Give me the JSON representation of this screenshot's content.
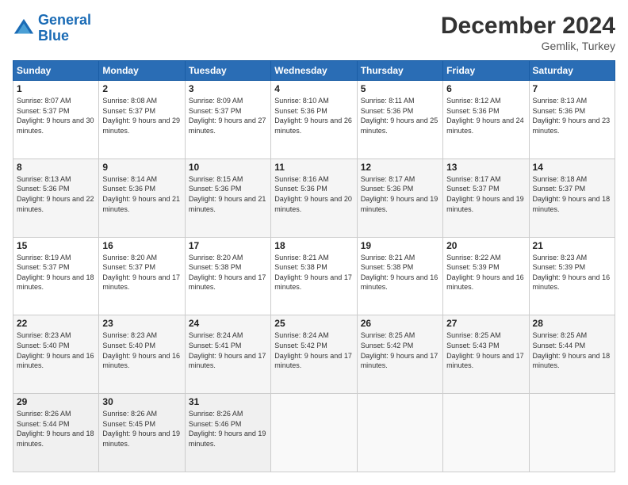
{
  "header": {
    "logo_line1": "General",
    "logo_line2": "Blue",
    "month_title": "December 2024",
    "subtitle": "Gemlik, Turkey"
  },
  "days_of_week": [
    "Sunday",
    "Monday",
    "Tuesday",
    "Wednesday",
    "Thursday",
    "Friday",
    "Saturday"
  ],
  "weeks": [
    [
      {
        "day": "1",
        "sunrise": "8:07 AM",
        "sunset": "5:37 PM",
        "daylight": "9 hours and 30 minutes."
      },
      {
        "day": "2",
        "sunrise": "8:08 AM",
        "sunset": "5:37 PM",
        "daylight": "9 hours and 29 minutes."
      },
      {
        "day": "3",
        "sunrise": "8:09 AM",
        "sunset": "5:37 PM",
        "daylight": "9 hours and 27 minutes."
      },
      {
        "day": "4",
        "sunrise": "8:10 AM",
        "sunset": "5:36 PM",
        "daylight": "9 hours and 26 minutes."
      },
      {
        "day": "5",
        "sunrise": "8:11 AM",
        "sunset": "5:36 PM",
        "daylight": "9 hours and 25 minutes."
      },
      {
        "day": "6",
        "sunrise": "8:12 AM",
        "sunset": "5:36 PM",
        "daylight": "9 hours and 24 minutes."
      },
      {
        "day": "7",
        "sunrise": "8:13 AM",
        "sunset": "5:36 PM",
        "daylight": "9 hours and 23 minutes."
      }
    ],
    [
      {
        "day": "8",
        "sunrise": "8:13 AM",
        "sunset": "5:36 PM",
        "daylight": "9 hours and 22 minutes."
      },
      {
        "day": "9",
        "sunrise": "8:14 AM",
        "sunset": "5:36 PM",
        "daylight": "9 hours and 21 minutes."
      },
      {
        "day": "10",
        "sunrise": "8:15 AM",
        "sunset": "5:36 PM",
        "daylight": "9 hours and 21 minutes."
      },
      {
        "day": "11",
        "sunrise": "8:16 AM",
        "sunset": "5:36 PM",
        "daylight": "9 hours and 20 minutes."
      },
      {
        "day": "12",
        "sunrise": "8:17 AM",
        "sunset": "5:36 PM",
        "daylight": "9 hours and 19 minutes."
      },
      {
        "day": "13",
        "sunrise": "8:17 AM",
        "sunset": "5:37 PM",
        "daylight": "9 hours and 19 minutes."
      },
      {
        "day": "14",
        "sunrise": "8:18 AM",
        "sunset": "5:37 PM",
        "daylight": "9 hours and 18 minutes."
      }
    ],
    [
      {
        "day": "15",
        "sunrise": "8:19 AM",
        "sunset": "5:37 PM",
        "daylight": "9 hours and 18 minutes."
      },
      {
        "day": "16",
        "sunrise": "8:20 AM",
        "sunset": "5:37 PM",
        "daylight": "9 hours and 17 minutes."
      },
      {
        "day": "17",
        "sunrise": "8:20 AM",
        "sunset": "5:38 PM",
        "daylight": "9 hours and 17 minutes."
      },
      {
        "day": "18",
        "sunrise": "8:21 AM",
        "sunset": "5:38 PM",
        "daylight": "9 hours and 17 minutes."
      },
      {
        "day": "19",
        "sunrise": "8:21 AM",
        "sunset": "5:38 PM",
        "daylight": "9 hours and 16 minutes."
      },
      {
        "day": "20",
        "sunrise": "8:22 AM",
        "sunset": "5:39 PM",
        "daylight": "9 hours and 16 minutes."
      },
      {
        "day": "21",
        "sunrise": "8:23 AM",
        "sunset": "5:39 PM",
        "daylight": "9 hours and 16 minutes."
      }
    ],
    [
      {
        "day": "22",
        "sunrise": "8:23 AM",
        "sunset": "5:40 PM",
        "daylight": "9 hours and 16 minutes."
      },
      {
        "day": "23",
        "sunrise": "8:23 AM",
        "sunset": "5:40 PM",
        "daylight": "9 hours and 16 minutes."
      },
      {
        "day": "24",
        "sunrise": "8:24 AM",
        "sunset": "5:41 PM",
        "daylight": "9 hours and 17 minutes."
      },
      {
        "day": "25",
        "sunrise": "8:24 AM",
        "sunset": "5:42 PM",
        "daylight": "9 hours and 17 minutes."
      },
      {
        "day": "26",
        "sunrise": "8:25 AM",
        "sunset": "5:42 PM",
        "daylight": "9 hours and 17 minutes."
      },
      {
        "day": "27",
        "sunrise": "8:25 AM",
        "sunset": "5:43 PM",
        "daylight": "9 hours and 17 minutes."
      },
      {
        "day": "28",
        "sunrise": "8:25 AM",
        "sunset": "5:44 PM",
        "daylight": "9 hours and 18 minutes."
      }
    ],
    [
      {
        "day": "29",
        "sunrise": "8:26 AM",
        "sunset": "5:44 PM",
        "daylight": "9 hours and 18 minutes."
      },
      {
        "day": "30",
        "sunrise": "8:26 AM",
        "sunset": "5:45 PM",
        "daylight": "9 hours and 19 minutes."
      },
      {
        "day": "31",
        "sunrise": "8:26 AM",
        "sunset": "5:46 PM",
        "daylight": "9 hours and 19 minutes."
      },
      null,
      null,
      null,
      null
    ]
  ]
}
